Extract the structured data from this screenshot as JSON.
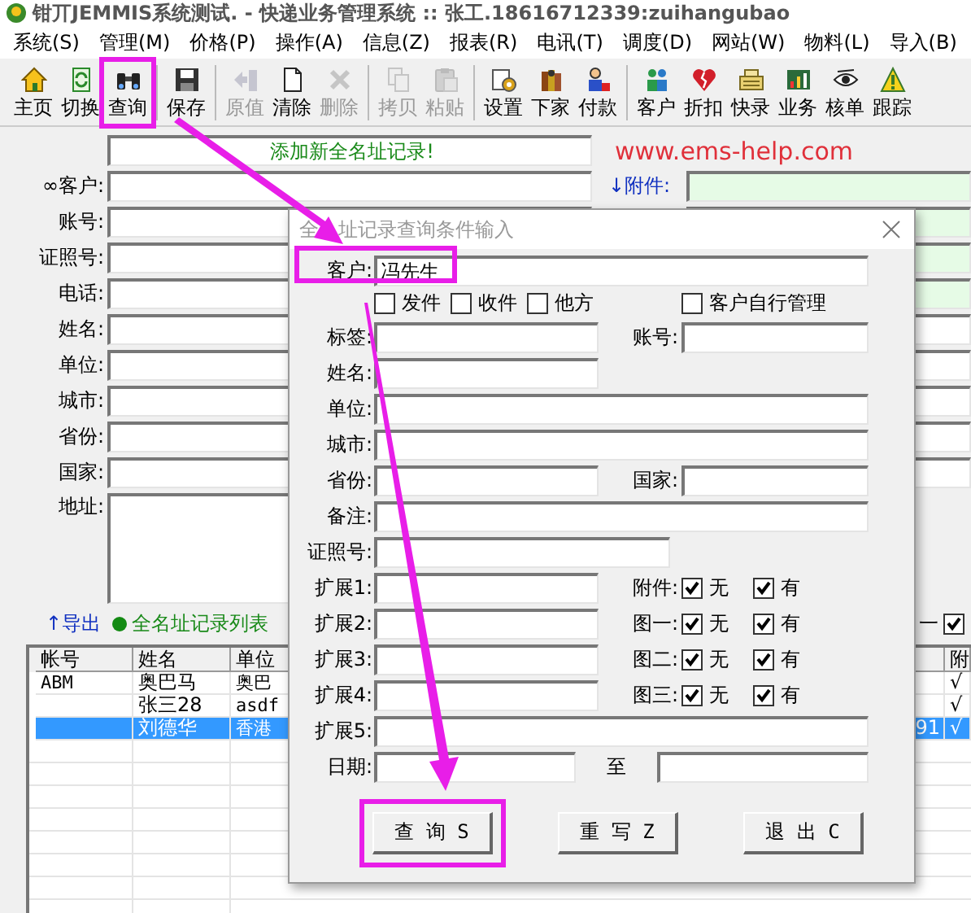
{
  "window": {
    "title": "钳丌JEMMIS系统测试. - 快递业务管理系统 :: 张工.18616712339:zuihangubao"
  },
  "menu": [
    "系统(S)",
    "管理(M)",
    "价格(P)",
    "操作(A)",
    "信息(Z)",
    "报表(R)",
    "电讯(T)",
    "调度(D)",
    "网站(W)",
    "物料(L)",
    "导入(B)"
  ],
  "toolbar": [
    [
      {
        "label": "主页",
        "disabled": false,
        "highlighted": false
      },
      {
        "label": "切换",
        "disabled": false,
        "highlighted": false
      },
      {
        "label": "查询",
        "disabled": false,
        "highlighted": true
      }
    ],
    [
      {
        "label": "保存",
        "disabled": false,
        "highlighted": false
      }
    ],
    [
      {
        "label": "原值",
        "disabled": true,
        "highlighted": false
      },
      {
        "label": "清除",
        "disabled": false,
        "highlighted": false
      },
      {
        "label": "删除",
        "disabled": true,
        "highlighted": false
      }
    ],
    [
      {
        "label": "拷贝",
        "disabled": true,
        "highlighted": false
      },
      {
        "label": "粘贴",
        "disabled": true,
        "highlighted": false
      }
    ],
    [
      {
        "label": "设置",
        "disabled": false,
        "highlighted": false
      },
      {
        "label": "下家",
        "disabled": false,
        "highlighted": false
      },
      {
        "label": "付款",
        "disabled": false,
        "highlighted": false
      }
    ],
    [
      {
        "label": "客户",
        "disabled": false,
        "highlighted": false
      },
      {
        "label": "折扣",
        "disabled": false,
        "highlighted": false
      },
      {
        "label": "快录",
        "disabled": false,
        "highlighted": false
      },
      {
        "label": "业务",
        "disabled": false,
        "highlighted": false
      },
      {
        "label": "核单",
        "disabled": false,
        "highlighted": false
      },
      {
        "label": "跟踪",
        "disabled": false,
        "highlighted": false
      }
    ]
  ],
  "form": {
    "banner": "添加新全名址记录!",
    "website": "www.ems-help.com",
    "rows": [
      {
        "label": "∞客户:",
        "side": {
          "label": "↓附件:",
          "tinted": true
        }
      },
      {
        "label": "账号:",
        "side": {
          "tinted": true
        }
      },
      {
        "label": "证照号:",
        "side": {
          "tinted": true
        }
      },
      {
        "label": "电话:",
        "side": {
          "tinted": true
        }
      },
      {
        "label": "姓名:",
        "side": {
          "tinted": false
        }
      },
      {
        "label": "单位:",
        "side": {
          "tinted": false
        }
      },
      {
        "label": "城市:",
        "side": {
          "tinted": false
        }
      },
      {
        "label": "省份:",
        "side": {
          "tinted": false
        }
      },
      {
        "label": "国家:",
        "side": {
          "tinted": false
        }
      },
      {
        "label": "地址:",
        "tall": true
      }
    ]
  },
  "list_bar": {
    "export": "↑导出",
    "title": "全名址记录列表",
    "end_text": "一",
    "checkbox": {
      "checked": true
    }
  },
  "table": {
    "columns": [
      "帐号",
      "姓名",
      "单位",
      "附"
    ],
    "rows": [
      {
        "cells": [
          "ABM",
          "奥巴马",
          "奥巴",
          "√"
        ],
        "selected": false
      },
      {
        "cells": [
          "",
          "张三28",
          "asdf",
          "√"
        ],
        "selected": false
      },
      {
        "cells": [
          "",
          "刘德华",
          "香港",
          "√"
        ],
        "column_4": "91",
        "selected": true
      }
    ]
  },
  "dialog": {
    "title": [
      "全",
      "址记录查询条件输入"
    ],
    "customer": {
      "label": "客户:",
      "value": "冯先生",
      "highlighted": true
    },
    "filters": [
      {
        "label": "发件",
        "checked": false
      },
      {
        "label": "收件",
        "checked": false
      },
      {
        "label": "他方",
        "checked": false
      }
    ],
    "self_managed": {
      "label": "客户自行管理",
      "checked": false
    },
    "rows": [
      {
        "label": "标签:",
        "kind": "short",
        "right": {
          "kind": "field",
          "label": "账号:"
        }
      },
      {
        "label": "姓名:",
        "kind": "short"
      },
      {
        "label": "单位:",
        "kind": "long"
      },
      {
        "label": "城市:",
        "kind": "long"
      },
      {
        "label": "省份:",
        "kind": "short",
        "right": {
          "kind": "field",
          "label": "国家:"
        }
      },
      {
        "label": "备注:",
        "kind": "long"
      },
      {
        "label": "证照号:",
        "kind": "medium"
      },
      {
        "label": "扩展1:",
        "kind": "short",
        "right": {
          "kind": "options",
          "label": "附件:",
          "options": [
            {
              "label": "无",
              "checked": true
            },
            {
              "label": "有",
              "checked": true
            }
          ]
        }
      },
      {
        "label": "扩展2:",
        "kind": "short",
        "right": {
          "kind": "options",
          "label": "图一:",
          "options": [
            {
              "label": "无",
              "checked": true
            },
            {
              "label": "有",
              "checked": true
            }
          ]
        }
      },
      {
        "label": "扩展3:",
        "kind": "short",
        "right": {
          "kind": "options",
          "label": "图二:",
          "options": [
            {
              "label": "无",
              "checked": true
            },
            {
              "label": "有",
              "checked": true
            }
          ]
        }
      },
      {
        "label": "扩展4:",
        "kind": "short",
        "right": {
          "kind": "options",
          "label": "图三:",
          "options": [
            {
              "label": "无",
              "checked": true
            },
            {
              "label": "有",
              "checked": true
            }
          ]
        }
      },
      {
        "label": "扩展5:",
        "kind": "long"
      },
      {
        "label": "日期:",
        "kind": "range",
        "separator": "至"
      }
    ],
    "buttons": [
      {
        "label": "查 询 S",
        "highlighted": true
      },
      {
        "label": "重 写 Z",
        "highlighted": false
      },
      {
        "label": "退 出 C",
        "highlighted": false
      }
    ]
  },
  "annotation_arrows": true
}
